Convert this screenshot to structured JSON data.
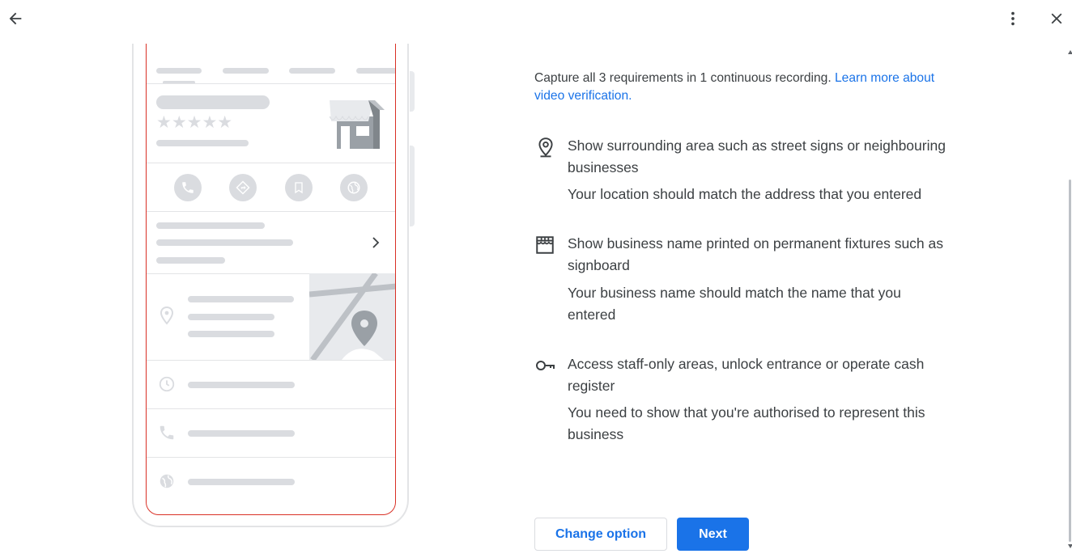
{
  "header": {
    "back_icon": "arrow-back-icon",
    "more_icon": "more-vert-icon",
    "close_icon": "close-icon"
  },
  "illustration": {
    "rating_stars": "★★★★★",
    "icons": [
      "phone-icon",
      "directions-icon",
      "bookmark-icon",
      "website-icon",
      "chevron-right-icon",
      "location-pin-icon",
      "clock-icon",
      "phone-icon",
      "globe-icon",
      "storefront-icon"
    ]
  },
  "intro": {
    "text": "Capture all 3 requirements in 1 continuous recording. ",
    "link": "Learn more about video verification."
  },
  "requirements": [
    {
      "icon": "location-pin-icon",
      "title": "Show surrounding area such as street signs or neighbouring businesses",
      "description": "Your location should match the address that you entered"
    },
    {
      "icon": "storefront-icon",
      "title": "Show business name printed on permanent fixtures such as signboard",
      "description": "Your business name should match the name that you entered"
    },
    {
      "icon": "key-icon",
      "title": "Access staff-only areas, unlock entrance or operate cash register",
      "description": "You need to show that you're authorised to represent this business"
    }
  ],
  "actions": {
    "change_option": "Change option",
    "next": "Next"
  },
  "colors": {
    "accent": "#1a73e8",
    "screen_outline": "#d93025",
    "placeholder": "#dadce0",
    "text": "#3c4043"
  }
}
